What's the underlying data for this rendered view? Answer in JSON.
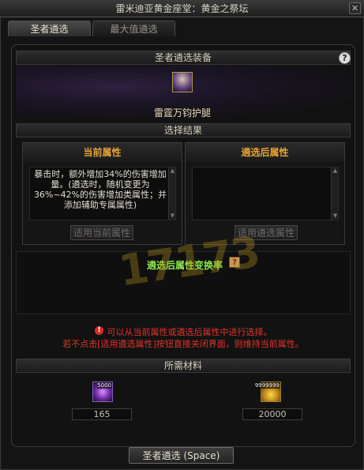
{
  "window": {
    "title": "雷米迪亚黄金座堂：黄金之祭坛",
    "close_glyph": "✕"
  },
  "tabs": [
    {
      "label": "圣者遴选"
    },
    {
      "label": "最大值遴选"
    }
  ],
  "equipment": {
    "section_title": "圣者遴选装备",
    "help_glyph": "?",
    "item_name": "雷霆万钧护腿"
  },
  "result": {
    "section_title": "选择结果",
    "current": {
      "title": "当前属性",
      "text": "暴击时，额外增加34%的伤害增加量。(遴选时，随机变更为36%~42%的伤害增加类属性；并添加辅助专属属性)",
      "button": "适用当前属性"
    },
    "selected": {
      "title": "遴选后属性",
      "text": "",
      "button": "适用遴选属性"
    }
  },
  "conversion": {
    "label": "遴选后属性变换率"
  },
  "warnings": {
    "line1": "可以从当前属性或遴选后属性中进行选择。",
    "line2": "若不点击[适用遴选属性]按钮直接关闭界面，则维持当前属性。"
  },
  "materials": {
    "section_title": "所需材料",
    "items": [
      {
        "icon": "purple-orb-icon",
        "badge": "5000",
        "value": "165"
      },
      {
        "icon": "gold-coin-icon",
        "badge": "9999999",
        "value": "20000"
      }
    ]
  },
  "action": {
    "label": "圣者遴选 (Space)"
  },
  "watermark": "17173"
}
